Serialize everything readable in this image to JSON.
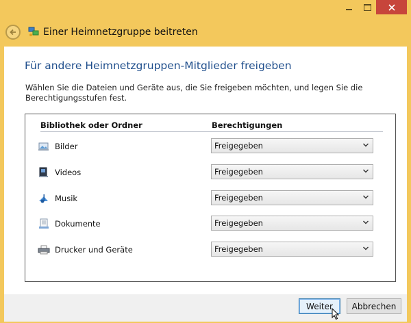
{
  "window": {
    "title": "Einer Heimnetzgruppe beitreten",
    "caption_buttons": {
      "minimize": "minimize-icon",
      "maximize": "maximize-icon",
      "close": "close-icon"
    },
    "colors": {
      "frame": "#f3c85c",
      "close": "#c7453b",
      "heading": "#1f4e8c"
    }
  },
  "page": {
    "heading": "Für andere Heimnetzgruppen-Mitglieder freigeben",
    "description_line1": "Wählen Sie die Dateien und Geräte aus, die Sie freigeben möchten, und legen Sie die",
    "description_line2": "Berechtigungsstufen fest."
  },
  "table": {
    "col_library": "Bibliothek oder Ordner",
    "col_permissions": "Berechtigungen",
    "rows": [
      {
        "label": "Bilder",
        "icon": "pictures-icon",
        "permission": "Freigegeben"
      },
      {
        "label": "Videos",
        "icon": "videos-icon",
        "permission": "Freigegeben"
      },
      {
        "label": "Musik",
        "icon": "music-icon",
        "permission": "Freigegeben"
      },
      {
        "label": "Dokumente",
        "icon": "documents-icon",
        "permission": "Freigegeben"
      },
      {
        "label": "Drucker und Geräte",
        "icon": "printer-icon",
        "permission": "Freigegeben"
      }
    ]
  },
  "footer": {
    "next_label": "Weiter",
    "cancel_label": "Abbrechen"
  }
}
